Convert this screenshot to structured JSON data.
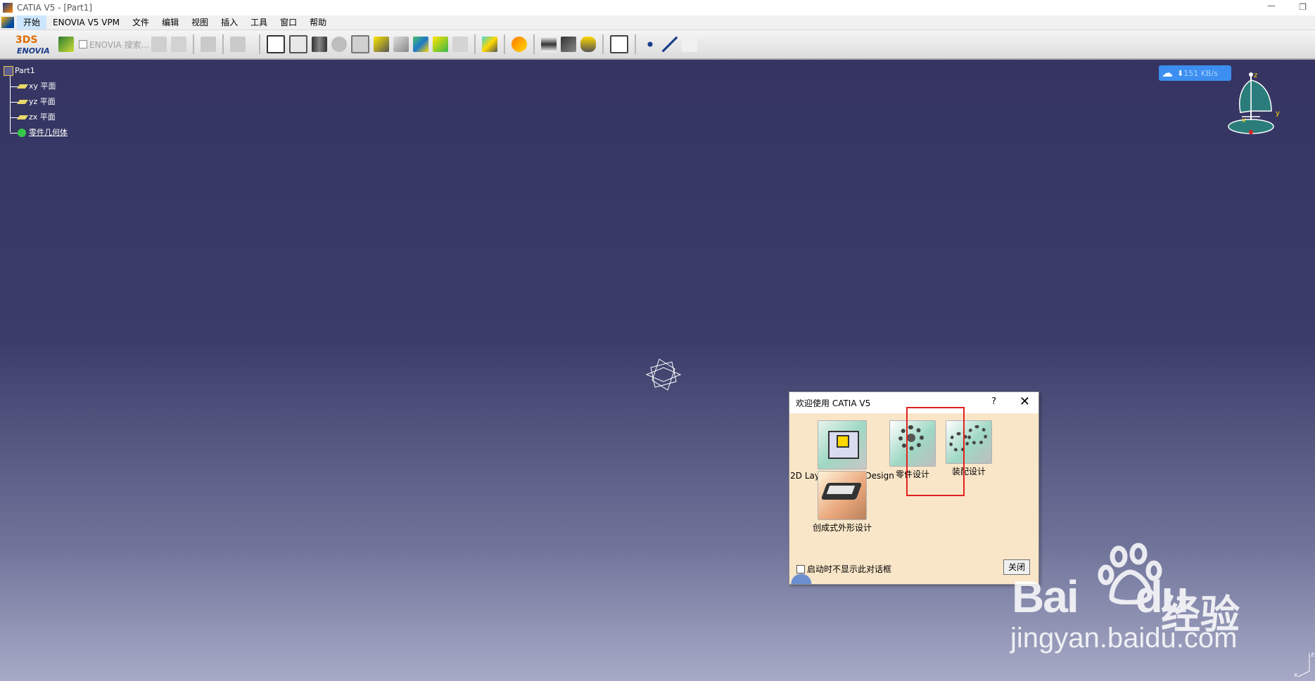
{
  "window": {
    "title": "CATIA V5 - [Part1]"
  },
  "menu": [
    "开始",
    "ENOVIA V5 VPM",
    "文件",
    "编辑",
    "视图",
    "插入",
    "工具",
    "窗口",
    "帮助"
  ],
  "toolbar": {
    "enovia_logo": "ENOVIA",
    "enovia_search": "ENOVIA 搜索..."
  },
  "tree": {
    "root": "Part1",
    "children": [
      "xy 平面",
      "yz 平面",
      "zx 平面",
      "零件几何体"
    ]
  },
  "speed_indicator": {
    "value": "151 KB/s"
  },
  "compass": {
    "axes": [
      "z",
      "x",
      "y"
    ]
  },
  "dialog": {
    "title": "欢迎使用 CATIA V5",
    "help": "?",
    "workbenches": [
      {
        "label": "2D Layout for 3D Design",
        "icon": "2d-layout-icon"
      },
      {
        "label": "零件设计",
        "icon": "part-design-icon"
      },
      {
        "label": "装配设计",
        "icon": "assembly-design-icon"
      },
      {
        "label": "创成式外形设计",
        "icon": "generative-shape-design-icon"
      }
    ],
    "checkbox_label": "启动时不显示此对话框",
    "close_button": "关闭"
  },
  "watermark": {
    "brand": "Bai",
    "brand2": "du",
    "site": "经验",
    "url": "jingyan.baidu.com"
  }
}
